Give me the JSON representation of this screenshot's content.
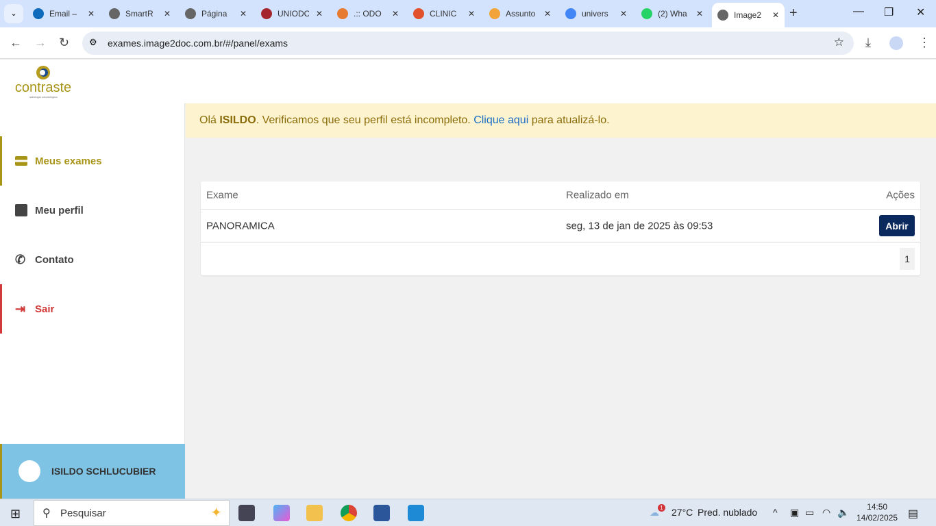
{
  "browser": {
    "tabs": [
      {
        "label": "Email –",
        "color": "#0f6cbd"
      },
      {
        "label": "SmartR",
        "color": "#666"
      },
      {
        "label": "Página",
        "color": "#666"
      },
      {
        "label": "UNIODO",
        "color": "#a4262c"
      },
      {
        "label": ".:: ODO",
        "color": "#e77b2f"
      },
      {
        "label": "CLINIC",
        "color": "#e0512c"
      },
      {
        "label": "Assunto",
        "color": "#f2a33a"
      },
      {
        "label": "univers",
        "color": "#4285f4"
      },
      {
        "label": "(2) Wha",
        "color": "#25d366"
      },
      {
        "label": "Image2",
        "color": "#666"
      }
    ],
    "url": "exames.image2doc.com.br/#/panel/exams"
  },
  "logo": {
    "text": "contraste",
    "subtitle": "radiologia odontológica"
  },
  "sidebar": {
    "items": [
      {
        "label": "Meus exames"
      },
      {
        "label": "Meu perfil"
      },
      {
        "label": "Contato"
      },
      {
        "label": "Sair"
      }
    ],
    "user": "ISILDO SCHLUCUBIER"
  },
  "alert": {
    "prefix": "Olá ",
    "name": "ISILDO",
    "middle": ". Verificamos que seu perfil está incompleto. ",
    "link": "Clique aqui",
    "suffix": " para atualizá-lo."
  },
  "table": {
    "headers": [
      "Exame",
      "Realizado em",
      "Ações"
    ],
    "rows": [
      {
        "exam": "PANORAMICA",
        "date": "seg, 13 de jan de 2025 às 09:53",
        "action": "Abrir"
      }
    ],
    "page": "1"
  },
  "taskbar": {
    "search": "Pesquisar",
    "weather": "27°C",
    "weather_desc": "Pred. nublado",
    "time": "14:50",
    "date": "14/02/2025",
    "badge": "1"
  }
}
